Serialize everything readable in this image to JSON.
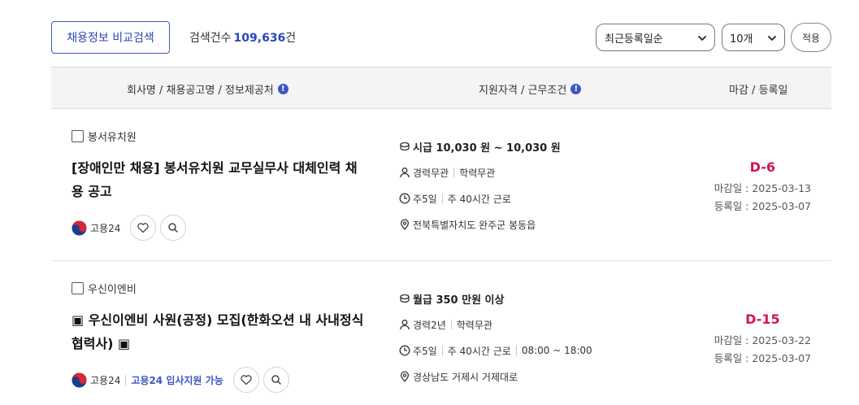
{
  "toolbar": {
    "compare_label": "채용정보 비교검색",
    "count_label": "검색건수",
    "count_value": "109,636",
    "count_unit": "건",
    "sort_value": "최근등록일순",
    "page_size_value": "10개",
    "apply_label": "적용"
  },
  "table": {
    "headers": [
      "회사명 / 채용공고명 / 정보제공처",
      "지원자격 / 근무조건",
      "마감 / 등록일"
    ]
  },
  "jobs": [
    {
      "company": "봉서유치원",
      "title": "[장애인만 채용] 봉서유치원 교무실무사 대체인력 채용 공고",
      "source": "고용24",
      "pay": "시급 10,030 원 ~ 10,030 원",
      "career": "경력무관",
      "education": "학력무관",
      "days": "주5일",
      "hours": "주 40시간 근로",
      "location": "전북특별자치도 완주군 봉동읍",
      "dday": "D-6",
      "deadline": "마감일 : 2025-03-13",
      "registered": "등록일 : 2025-03-07"
    },
    {
      "company": "우신이엔비",
      "title": "▣ 우신이엔비 사원(공정) 모집(한화오션 내 사내정식협력사) ▣",
      "source": "고용24",
      "support": "고용24 입사지원 가능",
      "pay": "월급 350 만원 이상",
      "career": "경력2년",
      "education": "학력무관",
      "days": "주5일",
      "hours": "주 40시간 근로",
      "time": "08:00 ~ 18:00",
      "location": "경상남도 거제시 거제대로",
      "dday": "D-15",
      "deadline": "마감일 : 2025-03-22",
      "registered": "등록일 : 2025-03-07"
    }
  ],
  "colors": {
    "accent": "#3d56c4",
    "dday": "#d1145a",
    "header_bg": "#f4f4f5"
  },
  "icons": [
    "info-icon",
    "chevron-down-icon",
    "coin-icon",
    "person-icon",
    "clock-icon",
    "location-pin-icon",
    "heart-icon",
    "search-icon",
    "goyong24-logo"
  ]
}
